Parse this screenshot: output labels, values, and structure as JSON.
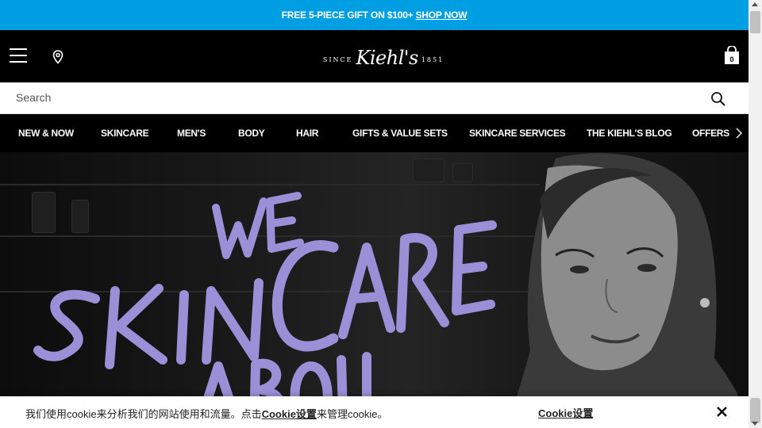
{
  "promo": {
    "text": "FREE 5-PIECE GIFT ON $100+",
    "link": "SHOP NOW"
  },
  "header": {
    "logo": {
      "since": "SINCE",
      "brand": "Kiehl's",
      "year": "1851"
    },
    "cart_count": "0",
    "icons": [
      "menu-icon",
      "location-pin-icon",
      "shopping-bag-icon"
    ]
  },
  "search": {
    "placeholder": "Search"
  },
  "nav": {
    "items": [
      {
        "label": "NEW & NOW"
      },
      {
        "label": "SKINCARE"
      },
      {
        "label": "MEN'S"
      },
      {
        "label": "BODY"
      },
      {
        "label": "HAIR"
      },
      {
        "label": "GIFTS & VALUE SETS"
      },
      {
        "label": "SKINCARE SERVICES"
      },
      {
        "label": "THE KIEHL'S BLOG"
      },
      {
        "label": "OFFERS"
      }
    ]
  },
  "hero": {
    "headline_lines": [
      "WE",
      "SKINCARE",
      "ABOUT"
    ],
    "headline_color": "#9b8fd8"
  },
  "cookie": {
    "msg_before": "我们使用cookie来分析我们的网站使用和流量。点击",
    "msg_link": "Cookie设置",
    "msg_after": "来管理cookie。",
    "settings_label": "Cookie设置"
  },
  "colors": {
    "promo_bg": "#009fe3",
    "header_bg": "#000000",
    "accent": "#9b8fd8"
  }
}
